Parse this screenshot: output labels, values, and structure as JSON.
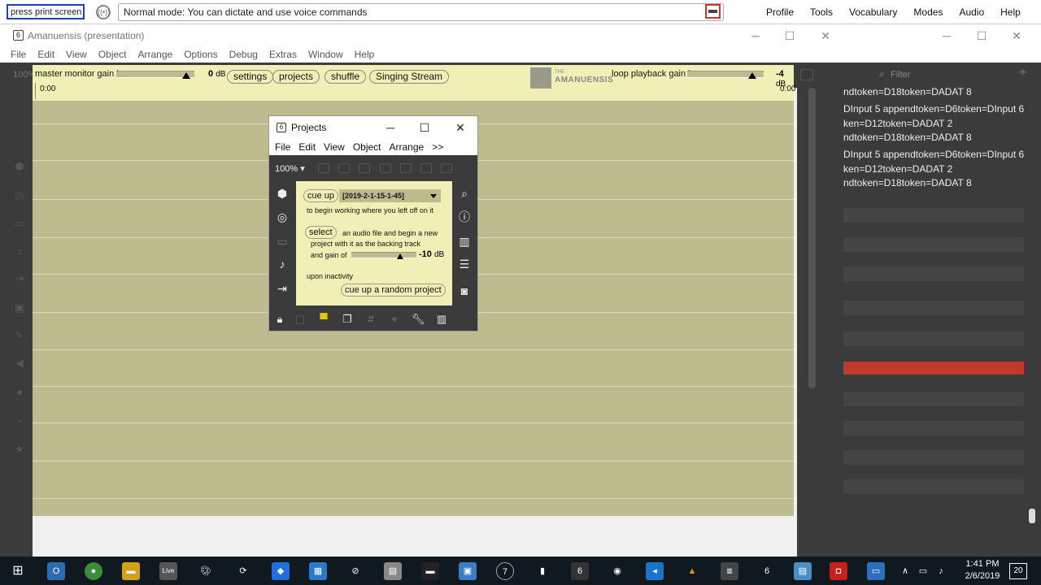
{
  "dictation": {
    "command_text": "press print screen",
    "mode_text": "Normal mode: You can dictate and use voice commands",
    "menu": [
      "Profile",
      "Tools",
      "Vocabulary",
      "Modes",
      "Audio",
      "Help"
    ]
  },
  "main_window": {
    "title": "Amanuensis (presentation)",
    "menu": [
      "File",
      "Edit",
      "View",
      "Object",
      "Arrange",
      "Options",
      "Debug",
      "Extras",
      "Window",
      "Help"
    ],
    "zoom": "100%"
  },
  "canvas": {
    "master_gain_label": "master monitor gain is",
    "master_gain_value": "0",
    "master_gain_unit": "dB",
    "master_gain_level": 0.9,
    "buttons": [
      "settings",
      "projects",
      "shuffle",
      "Singing Stream"
    ],
    "logo_small": "THE",
    "logo_name": "AMANUENSIS",
    "loop_gain_label": "loop playback gain is",
    "loop_gain_value": "-4",
    "loop_gain_unit": "dB",
    "loop_gain_level": 0.85,
    "time_start": "0:00",
    "time_end": "0:00"
  },
  "projects": {
    "title": "Projects",
    "menu": [
      "File",
      "Edit",
      "View",
      "Object",
      "Arrange",
      ">>"
    ],
    "zoom": "100%",
    "cue_up_label": "cue up",
    "project_selected": "[2019-2-1-15-1-45]",
    "cue_up_text": "to begin working where you left off on it",
    "select_label": "select",
    "select_text_1": "an audio file and begin a new",
    "select_text_2": "project with it as the backing track",
    "select_text_3": "and gain of",
    "gain_value": "-10",
    "gain_unit": "dB",
    "gain_level": 0.75,
    "inactivity_text": "upon inactivity",
    "random_button": "cue up a random project"
  },
  "right_panel": {
    "filter_placeholder": "Filter",
    "lines": [
      "ndtoken=D18token=DADAT 8",
      "DInput 5 appendtoken=D6token=DInput 6",
      "ken=D12token=DADAT 2",
      "ndtoken=D18token=DADAT 8",
      "DInput 5 appendtoken=D6token=DInput 6",
      "ken=D12token=DADAT 2",
      "ndtoken=D18token=DADAT 8"
    ]
  },
  "taskbar": {
    "time": "1:41 PM",
    "date": "2/6/2019",
    "notifications": "20",
    "live_label": "Live"
  }
}
